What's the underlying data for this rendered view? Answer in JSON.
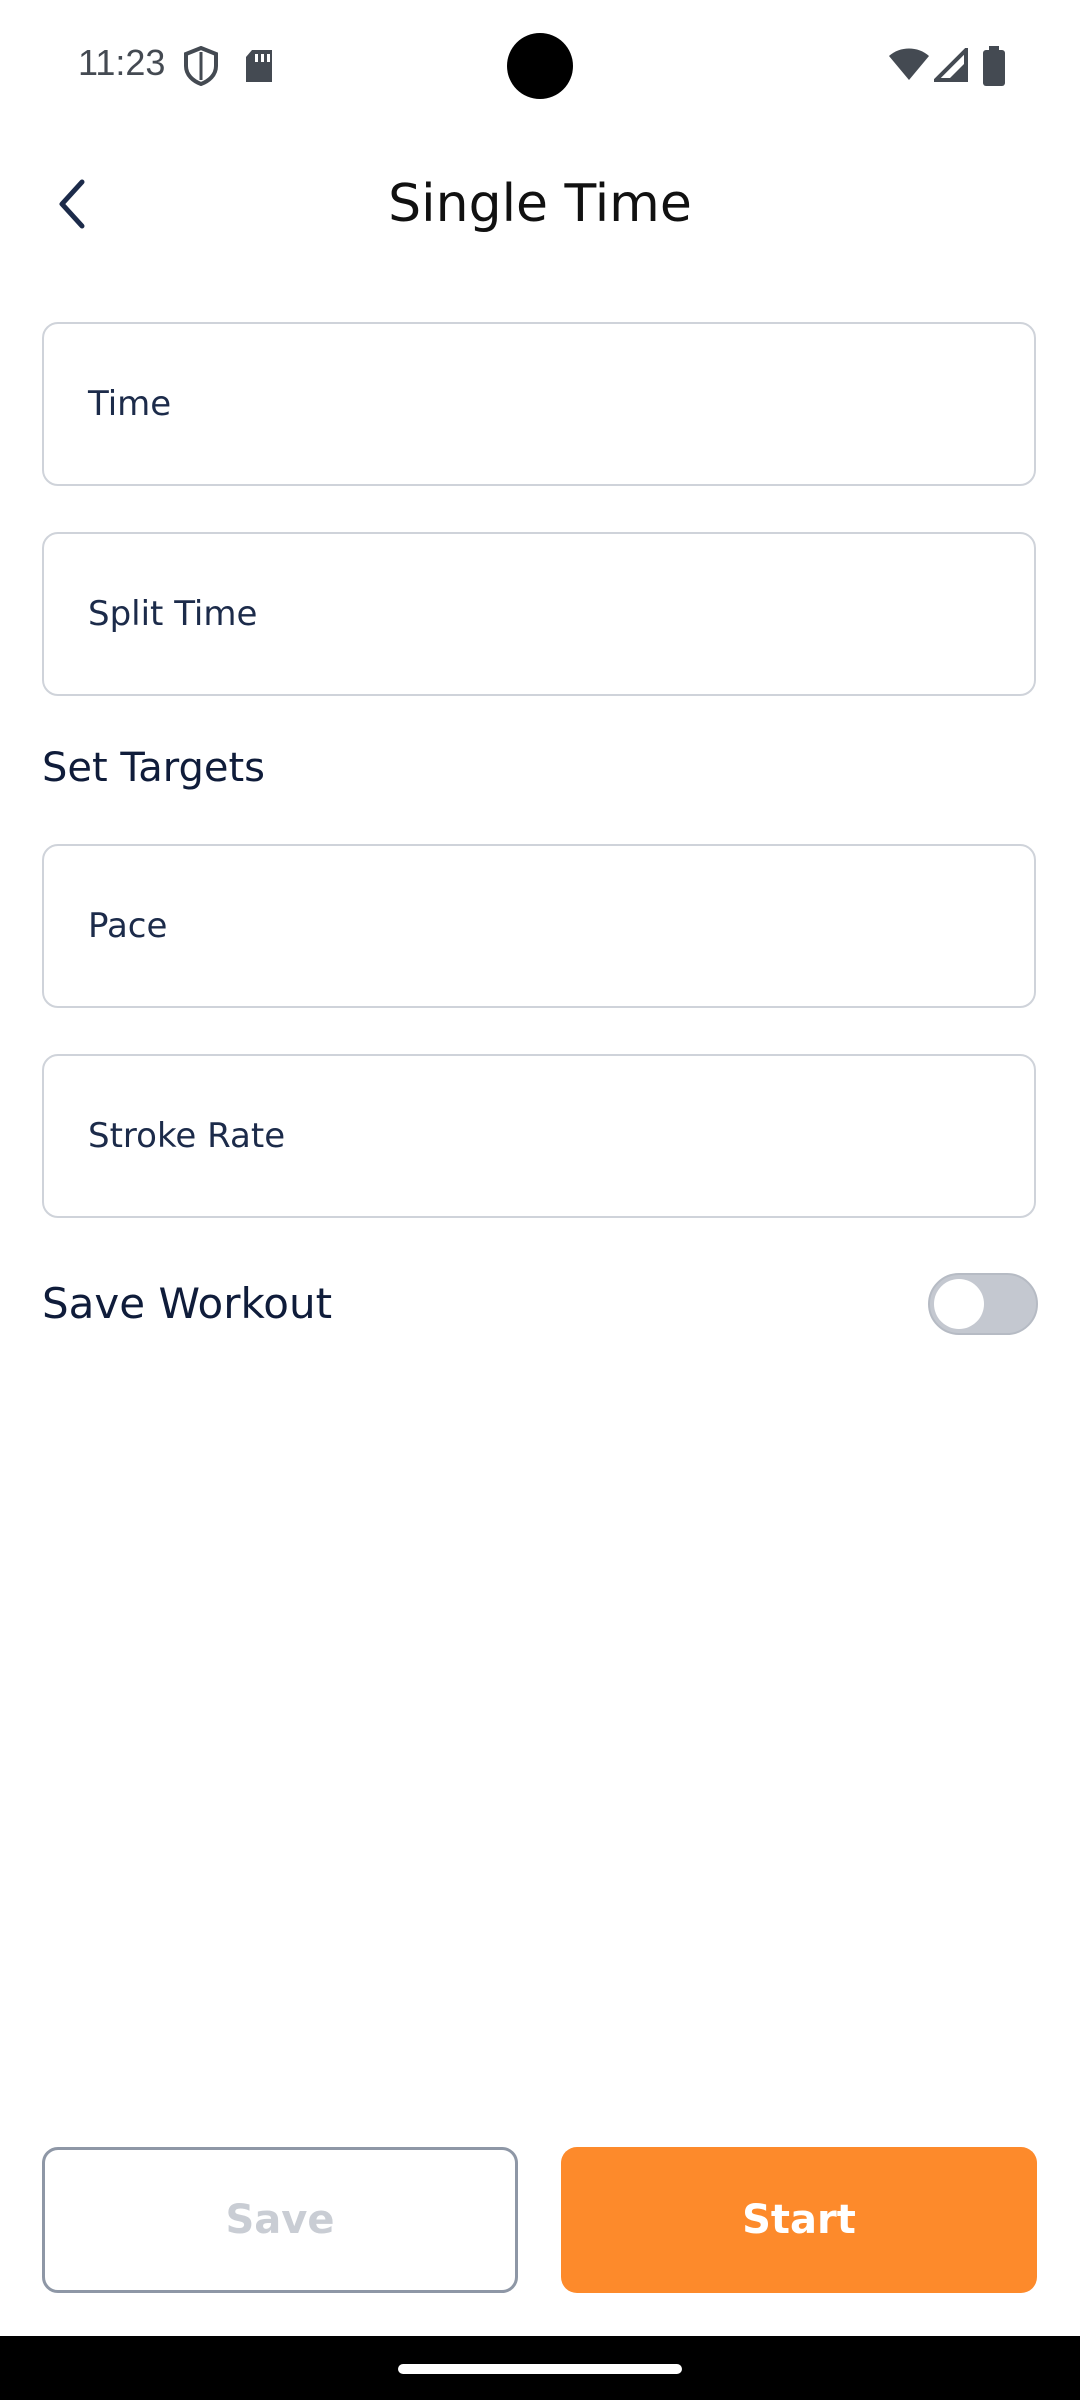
{
  "status_bar": {
    "time": "11:23",
    "icons": [
      "shield-icon",
      "sd-card-icon",
      "wifi-icon",
      "signal-icon",
      "battery-icon"
    ]
  },
  "header": {
    "title": "Single Time",
    "back_icon": "chevron-left-icon"
  },
  "fields": {
    "time": {
      "placeholder": "Time"
    },
    "split_time": {
      "placeholder": "Split Time"
    },
    "pace": {
      "placeholder": "Pace"
    },
    "stroke_rate": {
      "placeholder": "Stroke Rate"
    }
  },
  "section": {
    "targets_title": "Set Targets"
  },
  "save_workout": {
    "label": "Save Workout",
    "enabled": false
  },
  "buttons": {
    "save_label": "Save",
    "start_label": "Start"
  },
  "colors": {
    "accent": "#fd8a2b",
    "text_primary": "#0f1c3a",
    "border": "#cfd3da",
    "disabled_text": "#c9cdd4"
  }
}
